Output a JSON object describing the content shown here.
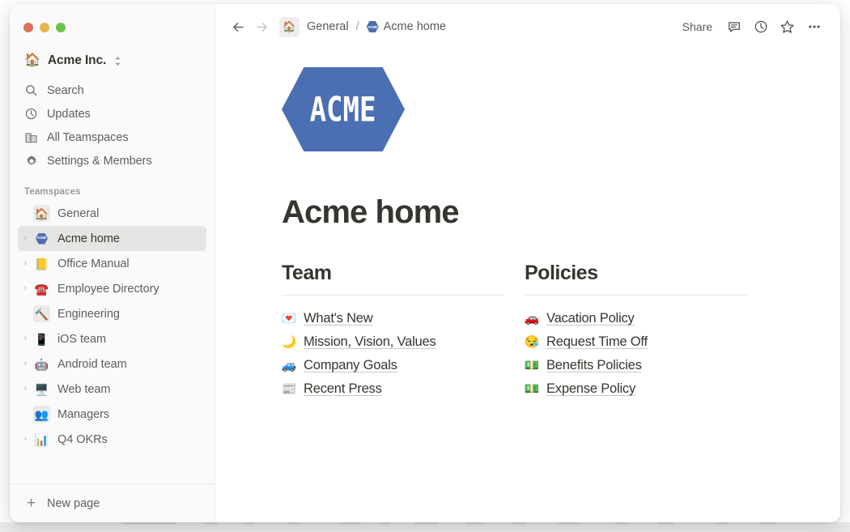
{
  "window": {
    "traffic_lights": [
      {
        "name": "close",
        "color": "#e06c60"
      },
      {
        "name": "minimize",
        "color": "#e9b44c"
      },
      {
        "name": "maximize",
        "color": "#6cc24a"
      }
    ]
  },
  "sidebar": {
    "workspace": {
      "emoji": "🏠",
      "name": "Acme Inc."
    },
    "nav": [
      {
        "icon": "search-icon",
        "label": "Search"
      },
      {
        "icon": "clock-icon",
        "label": "Updates"
      },
      {
        "icon": "building-icon",
        "label": "All Teamspaces"
      },
      {
        "icon": "gear-icon",
        "label": "Settings & Members"
      }
    ],
    "section_label": "Teamspaces",
    "teamspaces": [
      {
        "label": "General",
        "emoji": "🏠",
        "type": "header",
        "boxed": true,
        "chevron": false,
        "selected": false
      },
      {
        "label": "Acme home",
        "emoji": "",
        "type": "page",
        "boxed": false,
        "chevron": true,
        "selected": true,
        "badge": "ACME"
      },
      {
        "label": "Office Manual",
        "emoji": "📒",
        "type": "page",
        "boxed": false,
        "chevron": true,
        "selected": false
      },
      {
        "label": "Employee Directory",
        "emoji": "☎️",
        "type": "page",
        "boxed": false,
        "chevron": true,
        "selected": false
      },
      {
        "label": "Engineering",
        "emoji": "🔨",
        "type": "header",
        "boxed": true,
        "chevron": false,
        "selected": false
      },
      {
        "label": "iOS team",
        "emoji": "📱",
        "type": "page",
        "boxed": false,
        "chevron": true,
        "selected": false
      },
      {
        "label": "Android team",
        "emoji": "🤖",
        "type": "page",
        "boxed": false,
        "chevron": true,
        "selected": false
      },
      {
        "label": "Web team",
        "emoji": "🖥️",
        "type": "page",
        "boxed": false,
        "chevron": true,
        "selected": false
      },
      {
        "label": "Managers",
        "emoji": "👥",
        "type": "header",
        "boxed": true,
        "chevron": false,
        "selected": false
      },
      {
        "label": "Q4 OKRs",
        "emoji": "📊",
        "type": "page",
        "boxed": false,
        "chevron": true,
        "selected": false
      }
    ],
    "new_page_label": "New page"
  },
  "topbar": {
    "back_icon": "arrow-left-icon",
    "forward_icon": "arrow-right-icon",
    "home_emoji": "🏠",
    "crumb_parent": "General",
    "crumb_separator": "/",
    "crumb_page": "Acme home",
    "crumb_page_badge": "ACME",
    "share_label": "Share",
    "actions": [
      {
        "icon": "comment-icon"
      },
      {
        "icon": "clock-history-icon"
      },
      {
        "icon": "star-icon"
      },
      {
        "icon": "more-horizontal-icon"
      }
    ]
  },
  "page": {
    "logo_text": "ACME",
    "logo_color": "#4b6fb3",
    "title": "Acme home",
    "columns": [
      {
        "heading": "Team",
        "links": [
          {
            "emoji": "💌",
            "label": "What's New"
          },
          {
            "emoji": "🌙",
            "label": "Mission, Vision, Values"
          },
          {
            "emoji": "🚙",
            "label": "Company Goals"
          },
          {
            "emoji": "📰",
            "label": "Recent Press"
          }
        ]
      },
      {
        "heading": "Policies",
        "links": [
          {
            "emoji": "🚗",
            "label": "Vacation Policy"
          },
          {
            "emoji": "😪",
            "label": "Request Time Off"
          },
          {
            "emoji": "💵",
            "label": "Benefits Policies"
          },
          {
            "emoji": "💵",
            "label": "Expense Policy"
          }
        ]
      }
    ]
  }
}
